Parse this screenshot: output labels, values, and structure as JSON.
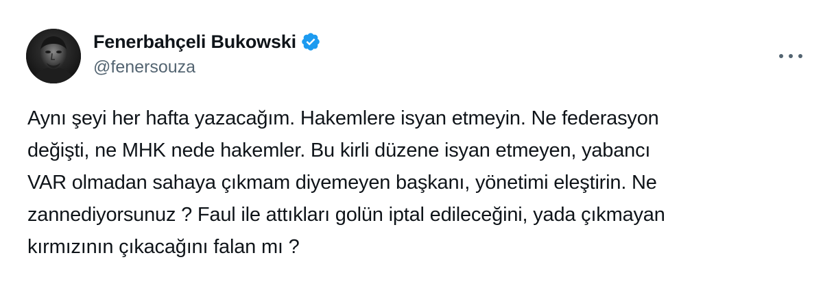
{
  "author": {
    "display_name": "Fenerbahçeli Bukowski",
    "handle": "@fenersouza",
    "verified": true
  },
  "tweet": {
    "lines": [
      "Aynı şeyi her hafta yazacağım. Hakemlere isyan etmeyin. Ne federasyon",
      "değişti, ne MHK nede hakemler. Bu kirli düzene isyan etmeyen, yabancı",
      "VAR olmadan sahaya çıkmam diyemeyen başkanı, yönetimi eleştirin. Ne",
      "zannediyorsunuz ? Faul ile attıkları golün iptal edileceğini, yada çıkmayan",
      "kırmızının çıkacağını falan mı ?"
    ]
  },
  "icons": {
    "verified": "verified-badge-icon",
    "more": "more-options-icon"
  },
  "colors": {
    "text_primary": "#0f1419",
    "text_secondary": "#536471",
    "verified_blue": "#1d9bf0",
    "background": "#ffffff"
  }
}
